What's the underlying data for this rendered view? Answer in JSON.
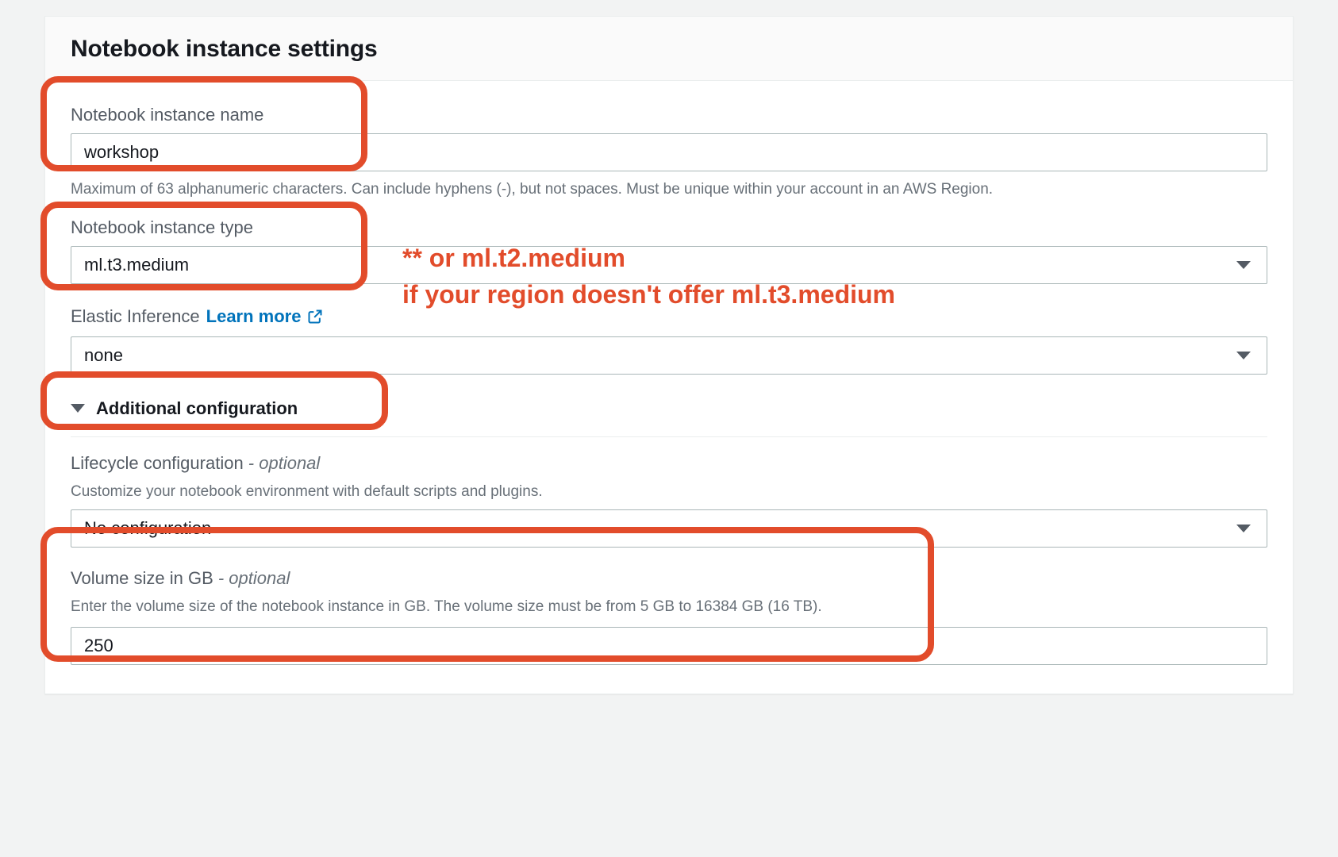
{
  "panel": {
    "title": "Notebook instance settings"
  },
  "name_field": {
    "label": "Notebook instance name",
    "value": "workshop",
    "help": "Maximum of 63 alphanumeric characters. Can include hyphens (-), but not spaces. Must be unique within your account in an AWS Region."
  },
  "type_field": {
    "label": "Notebook instance type",
    "value": "ml.t3.medium"
  },
  "elastic_inference": {
    "label": "Elastic Inference",
    "learn_more": "Learn more",
    "value": "none"
  },
  "additional_config": {
    "label": "Additional configuration"
  },
  "lifecycle": {
    "label": "Lifecycle configuration",
    "optional_suffix": " - optional",
    "help": "Customize your notebook environment with default scripts and plugins.",
    "value": "No configuration"
  },
  "volume": {
    "label": "Volume size in GB",
    "optional_suffix": " - optional",
    "help": "Enter the volume size of the notebook instance in GB. The volume size must be from 5 GB to 16384 GB (16 TB).",
    "value": "250"
  },
  "annotation": {
    "line1": "** or ml.t2.medium",
    "line2": "if your region doesn't offer ml.t3.medium"
  }
}
